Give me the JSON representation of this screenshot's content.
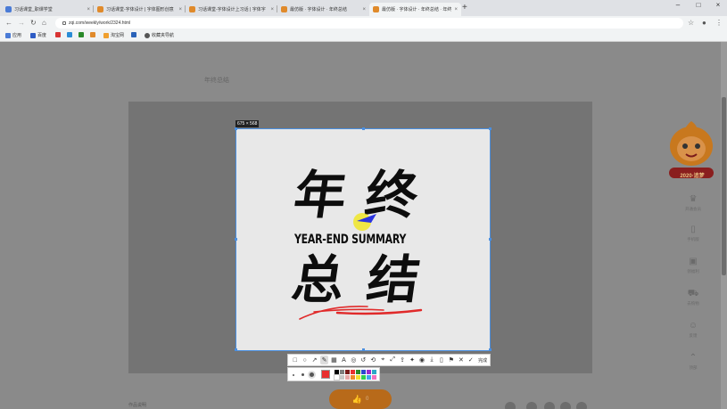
{
  "tabs": [
    {
      "title": "习话课堂_职课学堂",
      "icon": "page-icon",
      "color": "#4a7bd6"
    },
    {
      "title": "习话课堂-字体设计 | 字体图形创意",
      "icon": "page-icon",
      "color": "#e08a2b"
    },
    {
      "title": "习话课堂-字体设计上习话 | 字体字",
      "icon": "page-icon",
      "color": "#e08a2b"
    },
    {
      "title": "最仿版 · 字体设计 · 年终总结",
      "icon": "page-icon",
      "color": "#e08a2b"
    },
    {
      "title": "最仿版 · 字体设计 · 年终总结 · 年终",
      "icon": "page-icon",
      "color": "#e08a2b"
    }
  ],
  "address": {
    "url": "zqi.com/weekly/work/2324.html"
  },
  "bookmarks": [
    {
      "label": "应用",
      "color": "#4a7bd6"
    },
    {
      "label": "百度",
      "color": "#2e5cc5"
    },
    {
      "label": "",
      "color": "#d83434"
    },
    {
      "label": "",
      "color": "#2a8cd6"
    },
    {
      "label": "",
      "color": "#2a8a2a"
    },
    {
      "label": "",
      "color": "#e08a2b"
    },
    {
      "label": "淘宝网",
      "color": "#f0a030"
    },
    {
      "label": "",
      "color": "#2a62b8"
    },
    {
      "label": "收藏夹导航",
      "color": "#555555"
    }
  ],
  "page": {
    "work_title": "年终总结",
    "footer_left": "作品说明",
    "like_count": "0"
  },
  "capture": {
    "dimensions": "675 × 568"
  },
  "artwork": {
    "line1_char1": "年",
    "line1_char2": "终",
    "subtitle": "YEAR-END SUMMARY",
    "line2_char1": "总",
    "line2_char2": "结"
  },
  "toolbar": {
    "tools": [
      "rect-tool-icon",
      "ellipse-tool-icon",
      "arrow-tool-icon",
      "pen-tool-icon",
      "mosaic-tool-icon",
      "text-tool-icon",
      "number-tool-icon",
      "undo-icon",
      "rotate-icon",
      "pin-icon",
      "expand-icon",
      "share-icon",
      "magic-icon",
      "record-icon",
      "download-icon",
      "phone-icon",
      "bookmark-icon",
      "close-icon",
      "check-icon"
    ],
    "done_label": "完成"
  },
  "palette": {
    "current": "#e83030",
    "swatches": [
      "#000000",
      "#7f7f7f",
      "#7a1a1a",
      "#e83030",
      "#2a8a2a",
      "#2a4ad0",
      "#9a2ad0",
      "#2aa8c8",
      "#ffffff",
      "#c8c8c8",
      "#e8a8a8",
      "#f08a2a",
      "#f0e030",
      "#30d050",
      "#40a8f0",
      "#f070c0"
    ]
  },
  "rail": {
    "badge": "2020·追梦",
    "items": [
      {
        "icon": "crown-icon",
        "label": "开通会员"
      },
      {
        "icon": "phone-icon",
        "label": "手机版"
      },
      {
        "icon": "gift-icon",
        "label": "领福利"
      },
      {
        "icon": "cart-icon",
        "label": "去购物"
      },
      {
        "icon": "feedback-icon",
        "label": "反馈"
      },
      {
        "icon": "top-icon",
        "label": "顶部"
      }
    ]
  }
}
